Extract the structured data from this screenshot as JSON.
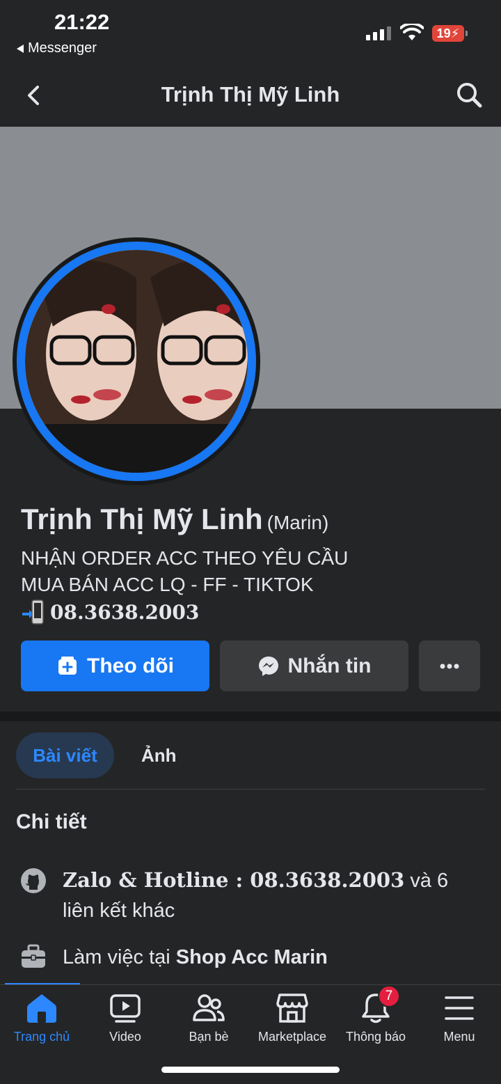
{
  "status": {
    "time": "21:22",
    "back_app": "Messenger",
    "battery": "19"
  },
  "header": {
    "title": "Trịnh Thị Mỹ Linh"
  },
  "profile": {
    "name": "Trịnh Thị Mỹ Linh",
    "alt_name": "(Marin)",
    "bio_line1": "NHẬN ORDER ACC THEO YÊU CẦU",
    "bio_line2": "MUA BÁN ACC LQ - FF - TIKTOK",
    "phone": "08.3638.2003"
  },
  "actions": {
    "follow_label": "Theo dõi",
    "message_label": "Nhắn tin"
  },
  "tabs": [
    {
      "label": "Bài viết",
      "active": true
    },
    {
      "label": "Ảnh",
      "active": false
    }
  ],
  "details": {
    "title": "Chi tiết",
    "links_prefix": "Zalo & Hotline : 08.3638.2003",
    "links_suffix": " và 6 liên kết khác",
    "work_prefix": "Làm việc tại ",
    "work_place": "Shop Acc Marin"
  },
  "nav": [
    {
      "label": "Trang chủ",
      "icon": "home-icon",
      "active": true
    },
    {
      "label": "Video",
      "icon": "video-icon",
      "active": false
    },
    {
      "label": "Bạn bè",
      "icon": "friends-icon",
      "active": false
    },
    {
      "label": "Marketplace",
      "icon": "marketplace-icon",
      "active": false
    },
    {
      "label": "Thông báo",
      "icon": "bell-icon",
      "active": false,
      "badge": "7"
    },
    {
      "label": "Menu",
      "icon": "menu-icon",
      "active": false
    }
  ],
  "colors": {
    "accent": "#1877f2",
    "background": "#242526",
    "badge": "#e41e3f"
  }
}
